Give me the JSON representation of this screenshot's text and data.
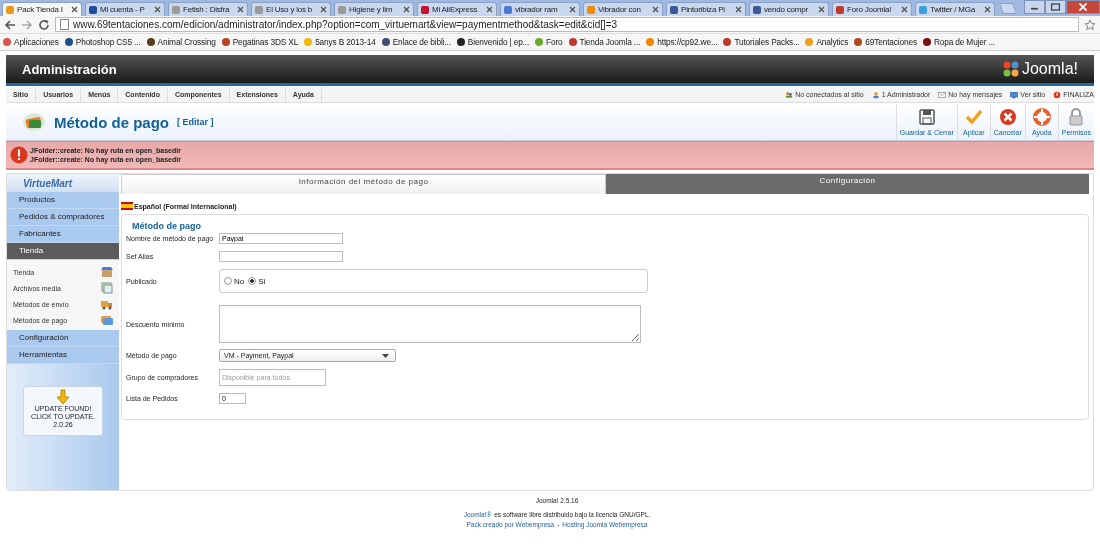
{
  "browser": {
    "tabs": [
      {
        "label": "Pack Tienda I",
        "selected": true,
        "color": "#e89a1c"
      },
      {
        "label": "Mi cuenta - P",
        "selected": false,
        "color": "#1f4f9c"
      },
      {
        "label": "Fetish : Disfra",
        "selected": false,
        "color": "#9a9a9a"
      },
      {
        "label": "El Uso y los b",
        "selected": false,
        "color": "#9a9a9a"
      },
      {
        "label": "Higiene y lim",
        "selected": false,
        "color": "#9a9a9a"
      },
      {
        "label": "Mi AliExpress",
        "selected": false,
        "color": "#c8102e"
      },
      {
        "label": "vibrador ram",
        "selected": false,
        "color": "#4a7bd0"
      },
      {
        "label": "Vibrador con",
        "selected": false,
        "color": "#f08a00"
      },
      {
        "label": "Pintoribiza Pi",
        "selected": false,
        "color": "#3b5998"
      },
      {
        "label": "vendo compr",
        "selected": false,
        "color": "#3b5998"
      },
      {
        "label": "Foro Joomla!",
        "selected": false,
        "color": "#c0392b"
      },
      {
        "label": "Twitter / MGa",
        "selected": false,
        "color": "#3aa0e0"
      }
    ],
    "url": "www.69tentaciones.com/edicion/administrator/index.php?option=com_virtuemart&view=paymentmethod&task=edit&cid[]=3",
    "bookmarks": [
      {
        "label": "Aplicaciones",
        "color": "#d9534f"
      },
      {
        "label": "Photoshop CS5 ...",
        "color": "#1b4f8a"
      },
      {
        "label": "Animal Crossing",
        "color": "#5a3a1a"
      },
      {
        "label": "Pegatinas 3DS XL",
        "color": "#b5451b"
      },
      {
        "label": "5anys B 2013-14",
        "color": "#f2b705"
      },
      {
        "label": "Enlace de bibli...",
        "color": "#3d4f73"
      },
      {
        "label": "Bienvenido | ep...",
        "color": "#222222"
      },
      {
        "label": "Foro",
        "color": "#6aaa2a"
      },
      {
        "label": "Tienda Joomla ...",
        "color": "#c0392b"
      },
      {
        "label": "https://cp92.we...",
        "color": "#f08a00"
      },
      {
        "label": "Tutoriales Packs...",
        "color": "#c0392b"
      },
      {
        "label": "Analytics",
        "color": "#f0a020"
      },
      {
        "label": "69Tentaciones",
        "color": "#b5451b"
      },
      {
        "label": "Ropa de Mujer ...",
        "color": "#7a1010"
      }
    ]
  },
  "header": {
    "title": "Administración",
    "logo": "Joomla!"
  },
  "menu": {
    "items": [
      "Sitio",
      "Usuarios",
      "Menús",
      "Contenido",
      "Componentes",
      "Extensiones",
      "Ayuda"
    ],
    "status": [
      {
        "label": "No conectados al sitio",
        "kind": "users"
      },
      {
        "label": "1 Administrador",
        "kind": "user"
      },
      {
        "label": "No hay mensajes",
        "kind": "mail"
      },
      {
        "label": "Ver sitio",
        "kind": "screen"
      },
      {
        "label": "FINALIZA",
        "kind": "logout"
      }
    ]
  },
  "toolbar": {
    "title": "Método de pago",
    "subtitle": "[ Editar ]",
    "buttons": [
      {
        "label": "Guardar & Cerrar",
        "kind": "save"
      },
      {
        "label": "Aplicar",
        "kind": "apply"
      },
      {
        "label": "Cancelar",
        "kind": "cancel"
      },
      {
        "label": "Ayuda",
        "kind": "help"
      },
      {
        "label": "Permisos",
        "kind": "lock"
      }
    ]
  },
  "errors": [
    "JFolder::create: No hay ruta en open_basedir",
    "JFolder::create: No hay ruta en open_basedir"
  ],
  "sidebar": {
    "logo": "VirtueMart",
    "items": [
      {
        "label": "Productos",
        "selected": false
      },
      {
        "label": "Pedidos & compradores",
        "selected": false
      },
      {
        "label": "Fabricantes",
        "selected": false
      },
      {
        "label": "Tienda",
        "selected": true,
        "expanded": true,
        "children": [
          {
            "label": "Tienda",
            "kind": "shop"
          },
          {
            "label": "Archivos media",
            "kind": "media"
          },
          {
            "label": "Métodos de envío",
            "kind": "shipping"
          },
          {
            "label": "Métodos de pago",
            "kind": "payment"
          }
        ]
      },
      {
        "label": "Configuración",
        "selected": false
      },
      {
        "label": "Herramientas",
        "selected": false
      }
    ],
    "update": [
      "UPDATE FOUND!",
      "CLICK TO UPDATE.",
      "2.0.26"
    ]
  },
  "tabs": [
    {
      "label": "Información del método de pago",
      "selected": true
    },
    {
      "label": "Configuración",
      "selected": false
    }
  ],
  "language": "Español (Formal Internacional)",
  "form": {
    "legend": "Método de pago",
    "fields": [
      {
        "label": "Nombre de método de pago",
        "kind": "text",
        "value": "Paypal"
      },
      {
        "label": "Sef Alias",
        "kind": "text"
      },
      {
        "label": "Publicado",
        "kind": "radio",
        "options": [
          {
            "label": "No",
            "selected": false
          },
          {
            "label": "Si",
            "selected": true
          }
        ]
      },
      {
        "label": "Descuento mínimo",
        "kind": "textarea"
      },
      {
        "label": "Método de pago",
        "kind": "select",
        "value": "VM - Payment, Paypal"
      },
      {
        "label": "Grupo de compradores",
        "kind": "text",
        "placeholder": "Disponible para todos"
      },
      {
        "label": "Lista de Pedidos",
        "kind": "short",
        "value": "0"
      }
    ]
  },
  "footer": {
    "version": "Joomla! 2.5.16",
    "license": [
      {
        "text": "Joomla!®",
        "link": true
      },
      {
        "text": "es software libre distribuido bajo la licencia GNU/GPL.",
        "link": false
      }
    ],
    "credits": {
      "links": [
        "Pack creado por Webempresa",
        "Hosting Joomla Webempresa"
      ],
      "separator": "-"
    }
  }
}
